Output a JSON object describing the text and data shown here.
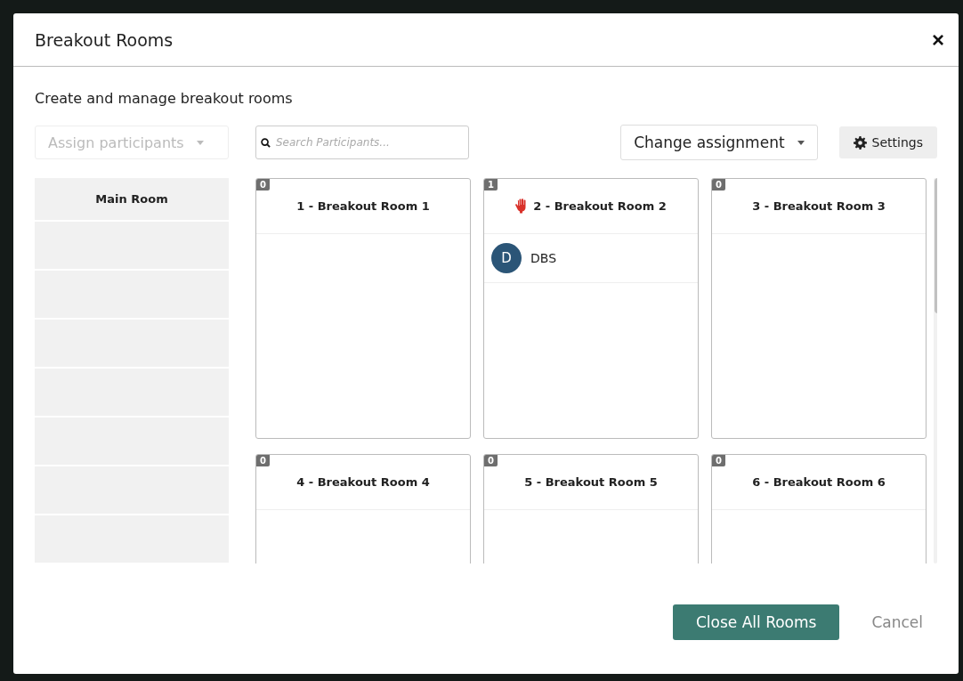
{
  "dialog": {
    "title": "Breakout Rooms",
    "close": "×",
    "subtitle": "Create and manage breakout rooms"
  },
  "toolbar": {
    "assign": {
      "label": "Assign participants",
      "disabled": true
    },
    "search": {
      "placeholder": "Search Participants..."
    },
    "change_assignment": "Change assignment",
    "settings": "Settings"
  },
  "main_room": {
    "title": "Main Room"
  },
  "rooms": [
    {
      "count": "0",
      "name": "1 - Breakout Room 1",
      "hand_raised": false
    },
    {
      "count": "1",
      "name": "2 - Breakout Room 2",
      "hand_raised": true,
      "participants": [
        {
          "initial": "D",
          "name": "DBS"
        }
      ]
    },
    {
      "count": "0",
      "name": "3 - Breakout Room 3",
      "hand_raised": false
    },
    {
      "count": "0",
      "name": "4 - Breakout Room 4",
      "hand_raised": false
    },
    {
      "count": "0",
      "name": "5 - Breakout Room 5",
      "hand_raised": false
    },
    {
      "count": "0",
      "name": "6 - Breakout Room 6",
      "hand_raised": false
    }
  ],
  "footer": {
    "primary": "Close All Rooms",
    "cancel": "Cancel"
  }
}
